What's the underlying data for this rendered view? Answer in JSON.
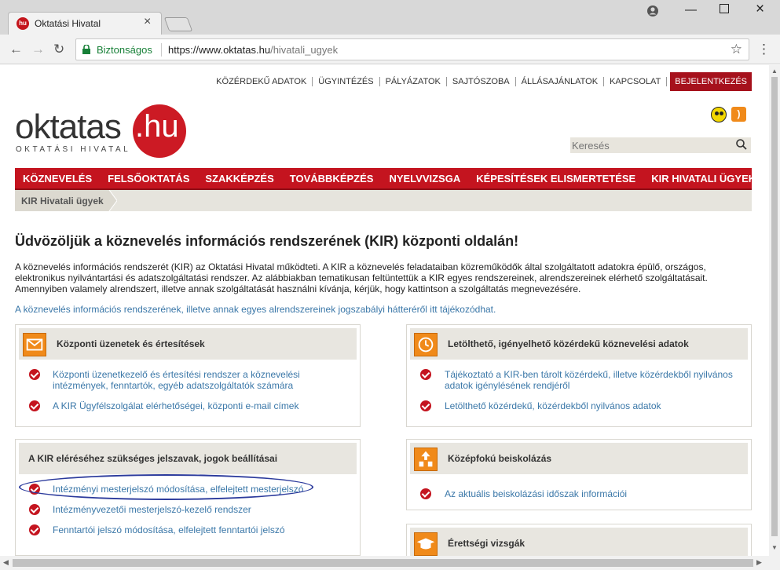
{
  "browser": {
    "tab_title": "Oktatási Hivatal",
    "favicon_text": "hu",
    "secure_label": "Biztonságos",
    "url_host": "https://www.oktatas.hu",
    "url_path": "/hivatali_ugyek"
  },
  "top_links": {
    "items": [
      "KÖZÉRDEKŰ ADATOK",
      "ÜGYINTÉZÉS",
      "PÁLYÁZATOK",
      "SAJTÓSZOBA",
      "ÁLLÁSAJÁNLATOK",
      "KAPCSOLAT"
    ],
    "login": "BEJELENTKEZÉS"
  },
  "logo": {
    "main": "oktatas",
    "hu": ".hu",
    "sub": "OKTATÁSI HIVATAL"
  },
  "search": {
    "placeholder": "Keresés"
  },
  "main_nav": [
    "KÖZNEVELÉS",
    "FELSŐOKTATÁS",
    "SZAKKÉPZÉS",
    "TOVÁBBKÉPZÉS",
    "NYELVVIZSGA",
    "KÉPESÍTÉSEK ELISMERTETÉSE",
    "KIR HIVATALI ÜGYEK"
  ],
  "breadcrumb": "KIR Hivatali ügyek",
  "title": "Üdvözöljük a köznevelés információs rendszerének (KIR) központi oldalán!",
  "intro": "A köznevelés információs rendszerét (KIR) az Oktatási Hivatal működteti. A KIR a köznevelés feladataiban közreműködők által szolgáltatott adatokra épülő, országos, elektronikus nyilvántartási és adatszolgáltatási rendszer. Az alábbiakban tematikusan feltüntettük a KIR egyes rendszereinek, alrendszereinek elérhető szolgáltatásait. Amennyiben valamely alrendszert, illetve annak szolgáltatását használni kívánja, kérjük, hogy kattintson a szolgáltatás megnevezésére.",
  "legal_link": "A köznevelés információs rendszerének, illetve annak egyes alrendszereinek jogszabályi hátteréről itt tájékozódhat.",
  "panels": {
    "p1": {
      "title": "Központi üzenetek és értesítések",
      "items": [
        "Központi üzenetkezelő és értesítési rendszer a köznevelési",
        "intézmények, fenntartók, egyéb adatszolgáltatók számára",
        "A KIR Ügyfélszolgálat elérhetőségei, központi e-mail címek"
      ]
    },
    "p2": {
      "title": "Letölthető, igényelhető közérdekű köznevelési adatok",
      "items": [
        "Tájékoztató a KIR-ben tárolt közérdekű, illetve közérdekből nyilvános",
        "adatok igénylésének rendjéről",
        "Letölthető közérdekű, közérdekből nyilvános adatok"
      ]
    },
    "p3": {
      "title": "A KIR eléréséhez szükséges jelszavak, jogok beállításai",
      "items": [
        "Intézményi mesterjelszó módosítása, elfelejtett mesterjelszó",
        "Intézményvezetői mesterjelszó-kezelő rendszer",
        "Fenntartói jelszó módosítása, elfelejtett fenntartói jelszó"
      ]
    },
    "p4": {
      "title": "Középfokú beiskolázás",
      "items": [
        "Az aktuális beiskolázási időszak információi"
      ]
    },
    "p5": {
      "title": "Érettségi vizsgák"
    }
  },
  "colors": {
    "brand_red": "#c4141f",
    "link_blue": "#3a77a8",
    "icon_orange": "#f08a1a"
  }
}
